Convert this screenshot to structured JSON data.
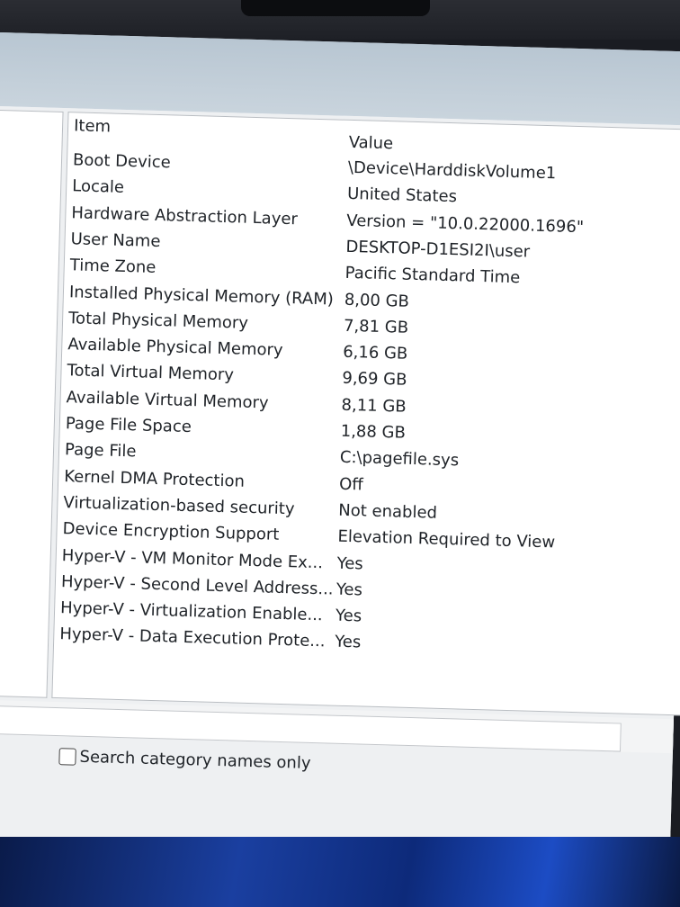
{
  "table": {
    "header": {
      "item": "Item",
      "value": "Value"
    },
    "rows": [
      {
        "item": "Boot Device",
        "value": "\\Device\\HarddiskVolume1"
      },
      {
        "item": "Locale",
        "value": "United States"
      },
      {
        "item": "Hardware Abstraction Layer",
        "value": "Version = \"10.0.22000.1696\""
      },
      {
        "item": "User Name",
        "value": "DESKTOP-D1ESI2I\\user"
      },
      {
        "item": "Time Zone",
        "value": "Pacific Standard Time"
      },
      {
        "item": "Installed Physical Memory (RAM)",
        "value": "8,00 GB"
      },
      {
        "item": "Total Physical Memory",
        "value": "7,81 GB"
      },
      {
        "item": "Available Physical Memory",
        "value": "6,16 GB"
      },
      {
        "item": "Total Virtual Memory",
        "value": "9,69 GB"
      },
      {
        "item": "Available Virtual Memory",
        "value": "8,11 GB"
      },
      {
        "item": "Page File Space",
        "value": "1,88 GB"
      },
      {
        "item": "Page File",
        "value": "C:\\pagefile.sys"
      },
      {
        "item": "Kernel DMA Protection",
        "value": "Off"
      },
      {
        "item": "Virtualization-based security",
        "value": "Not enabled"
      },
      {
        "item": "Device Encryption Support",
        "value": "Elevation Required to View"
      },
      {
        "item": "Hyper-V - VM Monitor Mode Ex...",
        "value": "Yes"
      },
      {
        "item": "Hyper-V - Second Level Address...",
        "value": "Yes"
      },
      {
        "item": "Hyper-V - Virtualization Enable...",
        "value": "Yes"
      },
      {
        "item": "Hyper-V - Data Execution Prote...",
        "value": "Yes"
      }
    ]
  },
  "search": {
    "checkbox_label": "Search category names only",
    "checked": false
  }
}
